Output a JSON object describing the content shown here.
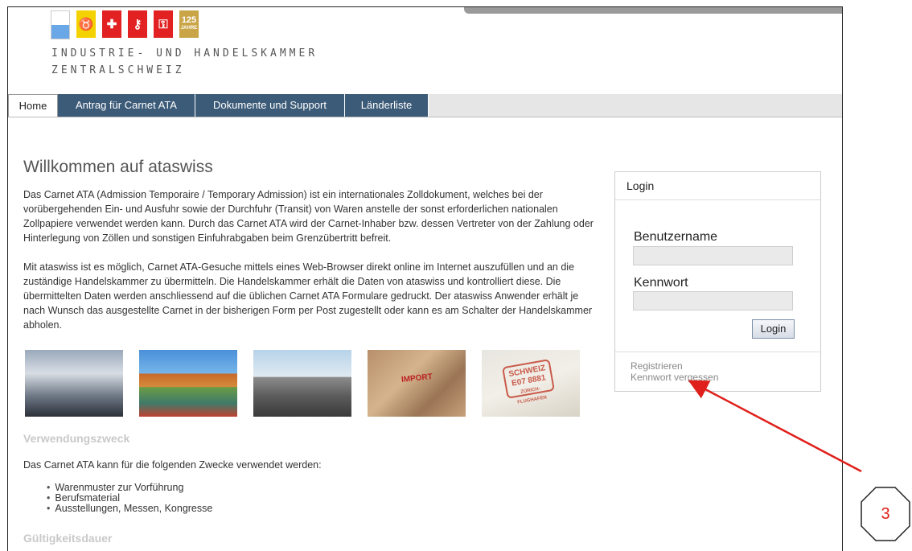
{
  "header": {
    "anniversary_badge": {
      "number": "125",
      "word": "JAHRE"
    },
    "org_line1": "INDUSTRIE- UND HANDELSKAMMER",
    "org_line2": "ZENTRALSCHWEIZ"
  },
  "nav": {
    "tabs": [
      {
        "label": "Home",
        "active": true
      },
      {
        "label": "Antrag für Carnet ATA",
        "active": false
      },
      {
        "label": "Dokumente und Support",
        "active": false
      },
      {
        "label": "Länderliste",
        "active": false
      }
    ]
  },
  "main": {
    "title": "Willkommen auf ataswiss",
    "intro": "Das Carnet ATA (Admission Temporaire / Temporary Admission) ist ein internationales Zolldokument, welches bei der vorübergehenden Ein- und Ausfuhr sowie der Durchfuhr (Transit) von Waren anstelle der sonst erforderlichen nationalen Zollpapiere verwendet werden kann. Durch das Carnet ATA wird der Carnet-Inhaber bzw. dessen Vertreter von der Zahlung oder Hinterlegung von Zöllen und sonstigen Einfuhrabgaben beim Grenzübertritt befreit.",
    "body": "Mit ataswiss ist es möglich, Carnet ATA-Gesuche mittels eines Web-Browser direkt online im Internet auszufüllen und an die zuständige Handelskammer zu übermitteln. Die Handelskammer erhält die Daten von ataswiss und kontrolliert diese. Die übermittelten Daten werden anschliessend auf die üblichen Carnet ATA Formulare gedruckt. Der ataswiss Anwender erhält je nach Wunsch das ausgestellte Carnet in der bisherigen Form per Post zugestellt oder kann es am Schalter der Handelskammer abholen.",
    "photo_texts": {
      "import_stamp": "IMPORT",
      "stamp_line1": "SCHWEIZ",
      "stamp_line2": "E07 8881",
      "stamp_line3": "ZÜRICH-FLUGHAFEN"
    },
    "section1_heading": "Verwendungszweck",
    "section1_text": "Das Carnet ATA kann für die folgenden Zwecke verwendet werden:",
    "uses": [
      "Warenmuster zur Vorführung",
      "Berufsmaterial",
      "Ausstellungen, Messen, Kongresse"
    ],
    "section2_heading": "Gültigkeitsdauer"
  },
  "login": {
    "title": "Login",
    "username_label": "Benutzername",
    "username_value": "",
    "password_label": "Kennwort",
    "password_value": "",
    "button_label": "Login",
    "register_link": "Registrieren",
    "forgot_link": "Kennwort vergessen"
  },
  "annotation": {
    "step_number": "3",
    "arrow_color": "#e0201b"
  }
}
